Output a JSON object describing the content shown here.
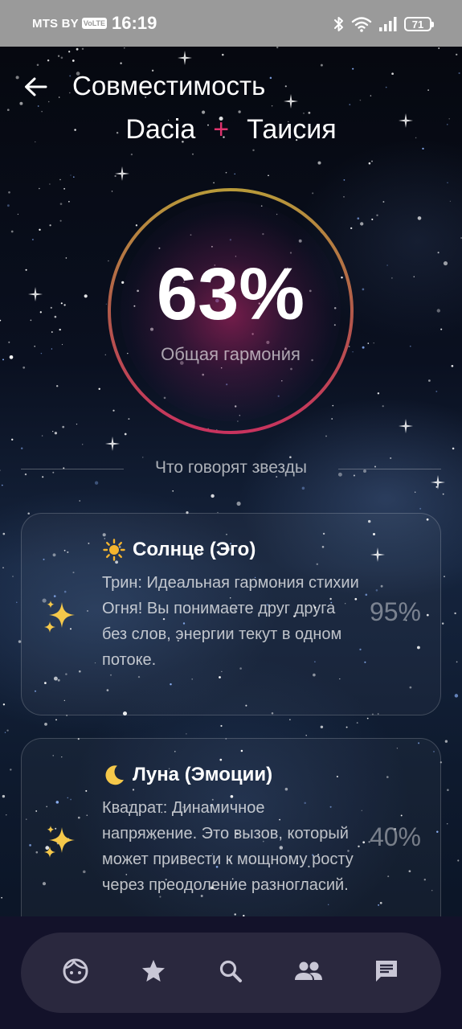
{
  "status_bar": {
    "carrier": "MTS BY",
    "volte": "VoLTE",
    "time": "16:19",
    "battery": "71"
  },
  "header": {
    "title": "Совместимость",
    "back_icon": "arrow-left-icon"
  },
  "names": {
    "first": "Dacia",
    "plus": "+",
    "second": "Таисия"
  },
  "harmony": {
    "percent": "63%",
    "label": "Общая гармония"
  },
  "section": {
    "title": "Что говорят звезды"
  },
  "cards": [
    {
      "icon": "sparkles-icon",
      "title_icon": "sun-icon",
      "title": "Солнце (Эго)",
      "text": "Трин: Идеальная гармония стихии Огня! Вы понимаете друг друга без слов, энергии текут в одном потоке.",
      "percent": "95%"
    },
    {
      "icon": "sparkles-icon",
      "title_icon": "crescent-moon-icon",
      "title": "Луна (Эмоции)",
      "text": "Квадрат: Динамичное напряжение. Это вызов, который может привести к мощному росту через преодоление разногласий.",
      "percent": "40%"
    }
  ],
  "bottom_nav": [
    {
      "icon": "face-icon"
    },
    {
      "icon": "star-icon"
    },
    {
      "icon": "search-icon"
    },
    {
      "icon": "people-icon"
    },
    {
      "icon": "chat-icon"
    }
  ],
  "colors": {
    "accent_pink": "#e0336e",
    "ring_gold": "#b89a3a",
    "ring_crimson": "#c8335e",
    "nav_bar": "#2a283e"
  }
}
